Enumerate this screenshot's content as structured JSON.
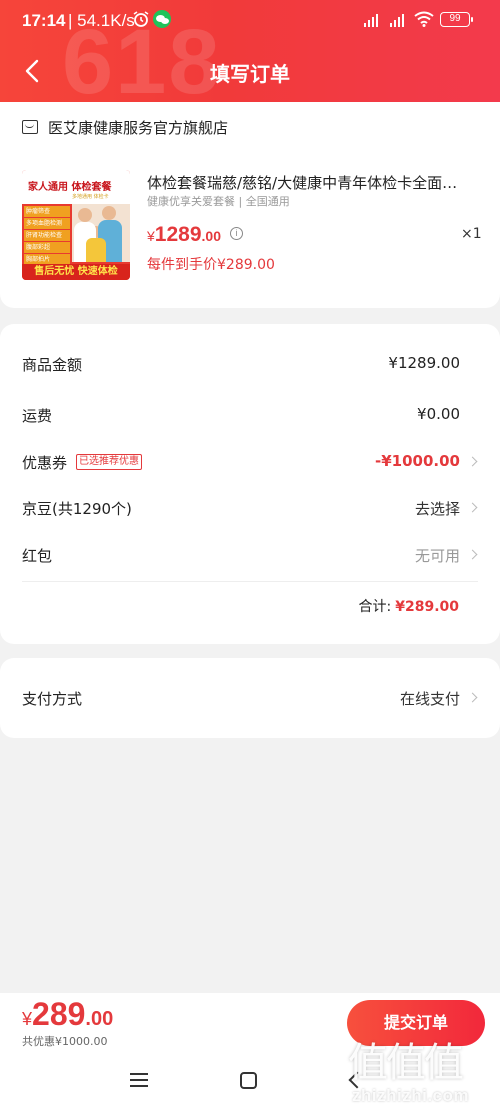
{
  "status_bar": {
    "time": "17:14",
    "speed": "54.1K/s",
    "battery": "99"
  },
  "header": {
    "title": "填写订单",
    "bg_text": "618"
  },
  "shop": {
    "name": "医艾康健康服务官方旗舰店"
  },
  "product": {
    "title": "体检套餐瑞慈/慈铭/大健康中青年体检卡全面…",
    "tags": "健康优享关爱套餐 | 全国通用",
    "price_symbol": "¥",
    "price_int": "1289",
    "price_dec": ".00",
    "quantity": "×1",
    "final_price": "每件到手价¥289.00",
    "image": {
      "title": "家人通用 体检套餐",
      "subtitle": "多地通用 体检卡",
      "items": [
        "肿瘤筛查",
        "多项血脂检测",
        "肝肾功能检查",
        "腹部彩超",
        "胸部拍片"
      ],
      "banner": "售后无忧 快速体检"
    }
  },
  "fees": {
    "goods_amount": {
      "label": "商品金额",
      "value": "¥1289.00"
    },
    "shipping": {
      "label": "运费",
      "value": "¥0.00"
    },
    "coupon": {
      "label": "优惠券",
      "badge": "已选推荐优惠",
      "value": "-¥1000.00"
    },
    "jingdou": {
      "label": "京豆(共1290个)",
      "value": "去选择"
    },
    "red_packet": {
      "label": "红包",
      "value": "无可用"
    },
    "total_label": "合计:",
    "total_value": "¥289.00"
  },
  "payment": {
    "label": "支付方式",
    "value": "在线支付"
  },
  "bottom": {
    "price_symbol": "¥",
    "price_int": "289",
    "price_dec": ".00",
    "saved": "共优惠¥1000.00",
    "submit": "提交订单"
  },
  "watermark": {
    "glyphs": "值值值",
    "text": "zhizhizhi.com"
  },
  "colors": {
    "accent": "#e4393c",
    "header_red": "#f13a3a",
    "background": "#f2f2f2"
  }
}
